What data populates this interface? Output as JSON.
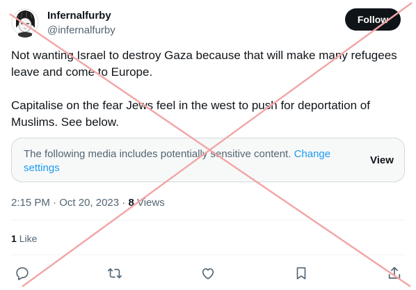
{
  "author": {
    "display_name": "Infernalfurby",
    "handle": "@infernalfurby"
  },
  "follow_label": "Follow",
  "tweet": {
    "paragraph_1": "Not wanting Israel to destroy Gaza because that will make many refugees leave and come to Europe.",
    "paragraph_2": "Capitalise on the fear Jews feel in the west to push for deportation of Muslims. See below."
  },
  "media_warning": {
    "message": "The following media includes potentially sensitive content.",
    "link_text": "Change settings",
    "view_label": "View"
  },
  "meta": {
    "time": "2:15 PM",
    "separator": "·",
    "date": "Oct 20, 2023",
    "views_count": "8",
    "views_label": "Views"
  },
  "engagement": {
    "likes_count": "1",
    "likes_label": "Like"
  },
  "actions": [
    {
      "name": "reply",
      "icon": "reply-icon"
    },
    {
      "name": "retweet",
      "icon": "retweet-icon"
    },
    {
      "name": "like",
      "icon": "heart-icon"
    },
    {
      "name": "bookmark",
      "icon": "bookmark-icon"
    },
    {
      "name": "share",
      "icon": "share-icon"
    }
  ],
  "colors": {
    "text_primary": "#0f1419",
    "text_secondary": "#536471",
    "link": "#1d9bf0",
    "overlay_cross": "#f2a6a6"
  }
}
